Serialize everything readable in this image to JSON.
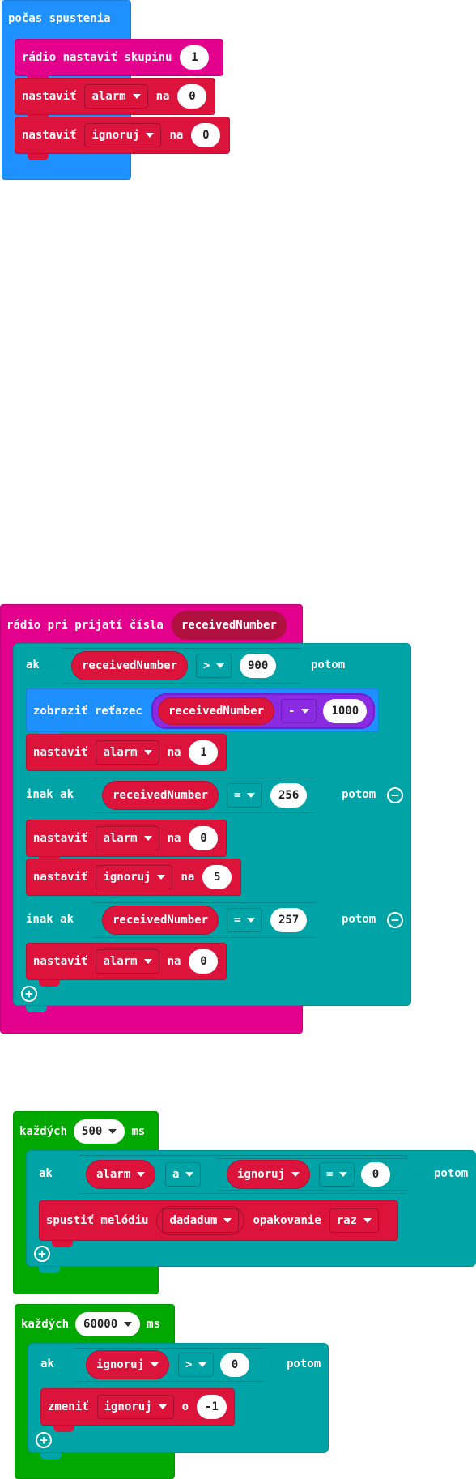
{
  "on_start": {
    "label": "počas spustenia",
    "radio_group": {
      "label": "rádio nastaviť skupinu",
      "value": "1"
    },
    "set_alarm": {
      "set": "nastaviť",
      "var": "alarm",
      "to": "na",
      "value": "0"
    },
    "set_ignore": {
      "set": "nastaviť",
      "var": "ignoruj",
      "to": "na",
      "value": "0"
    }
  },
  "on_radio": {
    "label": "rádio pri prijatí čísla",
    "param": "receivedNumber",
    "if1": {
      "kw": "ak",
      "var": "receivedNumber",
      "op": ">",
      "value": "900",
      "then": "potom"
    },
    "show": {
      "label": "zobraziť reťazec",
      "var": "receivedNumber",
      "op": "-",
      "value": "1000"
    },
    "set1": {
      "set": "nastaviť",
      "var": "alarm",
      "to": "na",
      "value": "1"
    },
    "elif1": {
      "kw": "inak ak",
      "var": "receivedNumber",
      "op": "=",
      "value": "256",
      "then": "potom"
    },
    "set2": {
      "set": "nastaviť",
      "var": "alarm",
      "to": "na",
      "value": "0"
    },
    "set3": {
      "set": "nastaviť",
      "var": "ignoruj",
      "to": "na",
      "value": "5"
    },
    "elif2": {
      "kw": "inak ak",
      "var": "receivedNumber",
      "op": "=",
      "value": "257",
      "then": "potom"
    },
    "set4": {
      "set": "nastaviť",
      "var": "alarm",
      "to": "na",
      "value": "0"
    }
  },
  "every1": {
    "label": "každých",
    "interval": "500",
    "unit": "ms",
    "if": {
      "kw": "ak",
      "var1": "alarm",
      "and": "a",
      "var2": "ignoruj",
      "op": "=",
      "value": "0",
      "then": "potom"
    },
    "play": {
      "label": "spustiť melódiu",
      "melody": "dadadum",
      "repeat_label": "opakovanie",
      "repeat": "raz"
    }
  },
  "every2": {
    "label": "každých",
    "interval": "60000",
    "unit": "ms",
    "if": {
      "kw": "ak",
      "var": "ignoruj",
      "op": ">",
      "value": "0",
      "then": "potom"
    },
    "change": {
      "label": "zmeniť",
      "var": "ignoruj",
      "by": "o",
      "value": "-1"
    }
  },
  "colors": {
    "events": "#1e90ff",
    "radio": "#e3008c",
    "loops": "#00a800",
    "logic": "#00a4a6",
    "variables": "#dc143c"
  },
  "icons": {
    "add": "plus-circle-icon",
    "remove": "minus-circle-icon",
    "dropdown": "triangle-down-icon"
  }
}
